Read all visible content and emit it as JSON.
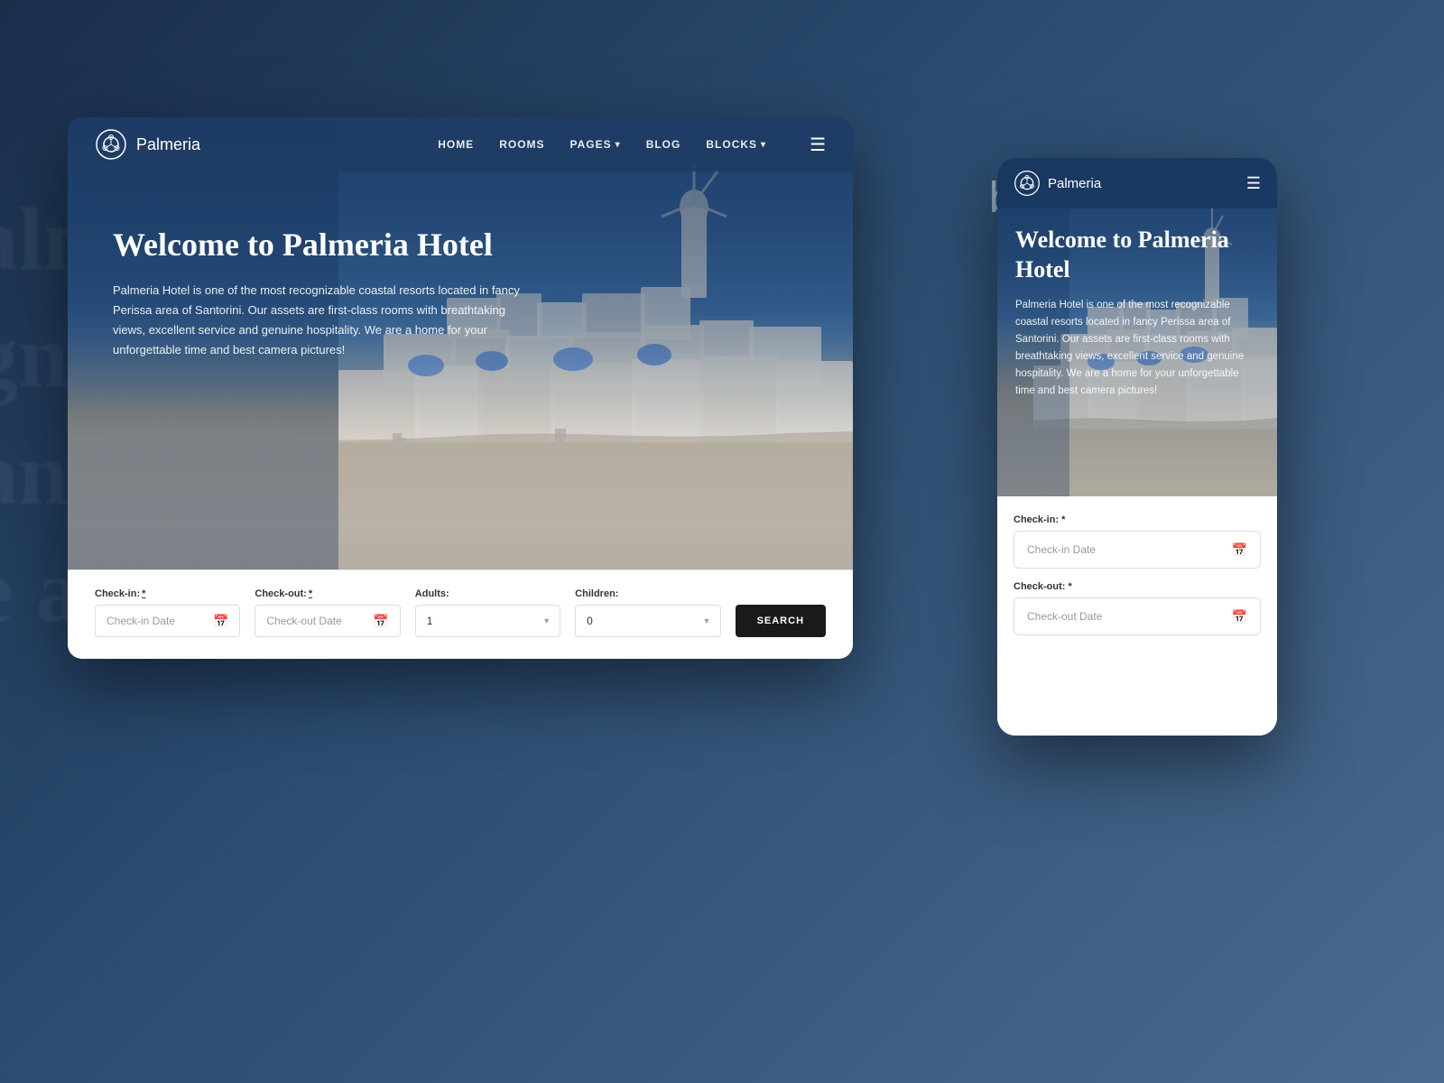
{
  "background": {
    "color": "#1a2e4a"
  },
  "bg_blur_text": {
    "line1": "alm",
    "line2": "gnriza",
    "line3": "ans o",
    "line4": "e a h"
  },
  "blocks_label": "blocKS",
  "desktop": {
    "nav": {
      "logo_text": "Palmeria",
      "links": [
        "HOME",
        "ROOMS",
        "PAGES",
        "BLOG",
        "BLOCKS"
      ],
      "pages_has_dropdown": true,
      "blocks_has_dropdown": true
    },
    "hero": {
      "title": "Welcome to Palmeria Hotel",
      "description": "Palmeria Hotel is one of the most recognizable coastal resorts located in fancy Perissa area of Santorini. Our assets are first-class rooms with breathtaking views, excellent service and genuine hospitality. We are a home for your unforgettable time and best camera pictures!"
    },
    "booking_form": {
      "checkin_label": "Check-in:",
      "checkin_required": "*",
      "checkin_placeholder": "Check-in Date",
      "checkout_label": "Check-out:",
      "checkout_required": "*",
      "checkout_placeholder": "Check-out Date",
      "adults_label": "Adults:",
      "adults_value": "1",
      "children_label": "Children:",
      "children_value": "0",
      "search_button": "SEARCH"
    }
  },
  "mobile": {
    "nav": {
      "logo_text": "Palmeria"
    },
    "hero": {
      "title": "Welcome to Palmeria Hotel",
      "description": "Palmeria Hotel is one of the most recognizable coastal resorts located in fancy Perissa area of Santorini. Our assets are first-class rooms with breathtaking views, excellent service and genuine hospitality. We are a home for your unforgettable time and best camera pictures!"
    },
    "booking_form": {
      "checkin_label": "Check-in: *",
      "checkin_placeholder": "Check-in Date",
      "checkout_label": "Check-out: *",
      "checkout_placeholder": "Check-out Date"
    }
  }
}
